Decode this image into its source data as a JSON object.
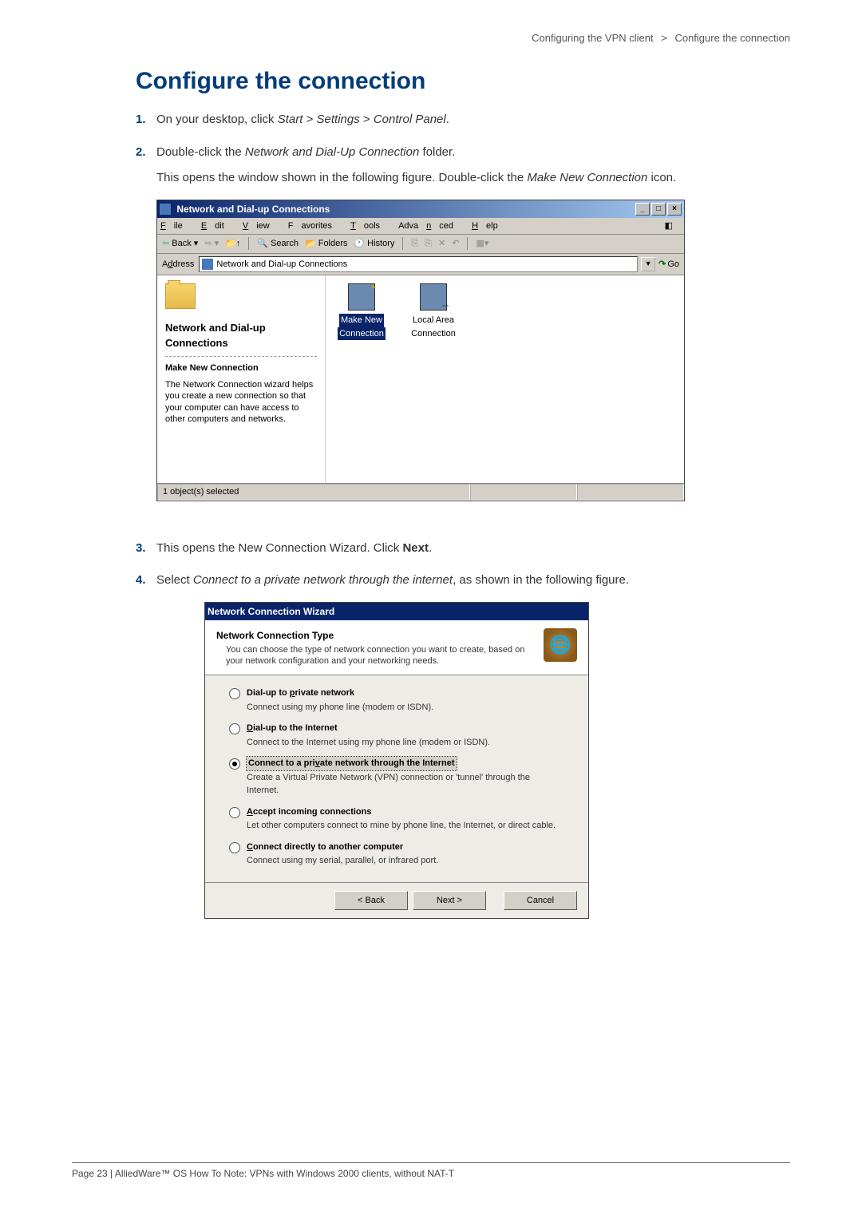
{
  "breadcrumb": {
    "section": "Configuring the VPN client",
    "page": "Configure the connection"
  },
  "heading": "Configure the connection",
  "steps": {
    "s1_num": "1.",
    "s1_a": "On your desktop, click ",
    "s1_b": "Start",
    "s1_c": " > ",
    "s1_d": "Settings",
    "s1_e": " > ",
    "s1_f": "Control Panel",
    "s1_g": ".",
    "s2_num": "2.",
    "s2_a": "Double-click the ",
    "s2_b": "Network and Dial-Up Connection",
    "s2_c": " folder.",
    "s2_p1a": "This opens the window shown in the following figure. Double-click the ",
    "s2_p1b": "Make New Connection",
    "s2_p1c": " icon.",
    "s3_num": "3.",
    "s3_a": "This opens the New Connection Wizard. Click ",
    "s3_b": "Next",
    "s3_c": ".",
    "s4_num": "4.",
    "s4_a": "Select ",
    "s4_b": "Connect to a private network through the internet",
    "s4_c": ", as shown in the following figure."
  },
  "window1": {
    "title": "Network and Dial-up Connections",
    "wbtn_min": "_",
    "wbtn_max": "□",
    "wbtn_close": "×",
    "menu": {
      "file_u": "F",
      "file": "ile",
      "edit_u": "E",
      "edit": "dit",
      "view_u": "V",
      "view": "iew",
      "fav": "F",
      "fav2": "avorites",
      "tools_u": "T",
      "tools": "ools",
      "adv": "Adva",
      "adv_u": "n",
      "adv2": "ced",
      "help_u": "H",
      "help": "elp"
    },
    "toolbar": {
      "back": "Back",
      "search": "Search",
      "folders": "Folders",
      "history": "History"
    },
    "address": {
      "label_u": "d",
      "label1": "A",
      "label2": "dress",
      "value": "Network and Dial-up Connections",
      "go": "Go"
    },
    "leftpane": {
      "title1": "Network and Dial-up",
      "title2": "Connections",
      "sub": "Make New Connection",
      "desc": "The Network Connection wizard helps you create a new connection so that your computer can have access to other computers and networks."
    },
    "icons": {
      "i1a": "Make New",
      "i1b": "Connection",
      "i2a": "Local Area",
      "i2b": "Connection"
    },
    "status": "1 object(s) selected"
  },
  "wizard": {
    "title": "Network Connection Wizard",
    "hdr_title": "Network Connection Type",
    "hdr_desc": "You can choose the type of network connection you want to create, based on your network configuration and your networking needs.",
    "opts": [
      {
        "u": "p",
        "pre": "Dial-up to ",
        "urest": "rivate network",
        "desc": "Connect using my phone line (modem or ISDN)."
      },
      {
        "u": "D",
        "pre": "",
        "urest": "ial-up to the Internet",
        "desc": "Connect to the Internet using my phone line (modem or ISDN)."
      },
      {
        "u": "v",
        "pre": "Connect to a pri",
        "urest": "ate network through the Internet",
        "desc": "Create a Virtual Private Network (VPN) connection or 'tunnel' through the Internet."
      },
      {
        "u": "A",
        "pre": "",
        "urest": "ccept incoming connections",
        "desc": "Let other computers connect to mine by phone line, the Internet, or direct cable."
      },
      {
        "u": "C",
        "pre": "",
        "urest": "onnect directly to another computer",
        "desc": "Connect using my serial, parallel, or infrared port."
      }
    ],
    "btn_back": "< Back",
    "btn_next": "Next >",
    "btn_cancel": "Cancel"
  },
  "footer": "Page 23 | AlliedWare™ OS How To Note: VPNs with Windows 2000 clients, without NAT-T"
}
